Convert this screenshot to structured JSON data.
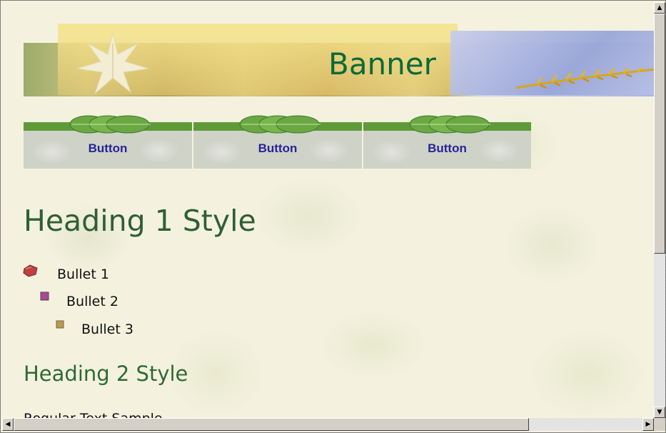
{
  "banner": {
    "title": "Banner"
  },
  "nav": {
    "buttons": [
      {
        "label": "Button"
      },
      {
        "label": "Button"
      },
      {
        "label": "Button"
      }
    ]
  },
  "content": {
    "heading1": "Heading 1 Style",
    "bullets": [
      "Bullet 1",
      "Bullet 2",
      "Bullet 3"
    ],
    "heading2": "Heading 2 Style",
    "body_text": "Regular Text Sample"
  },
  "colors": {
    "banner_title": "#0c6a39",
    "heading": "#2f5f33",
    "button_label": "#24249a",
    "nav_bar": "#5f9a3a"
  },
  "icons": [
    "leaf-icon",
    "wheat-icon",
    "leaf-cluster-icon",
    "bullet-red-icon",
    "bullet-purple-icon",
    "bullet-tan-icon",
    "arrow-up-icon",
    "arrow-down-icon",
    "arrow-left-icon",
    "arrow-right-icon"
  ]
}
